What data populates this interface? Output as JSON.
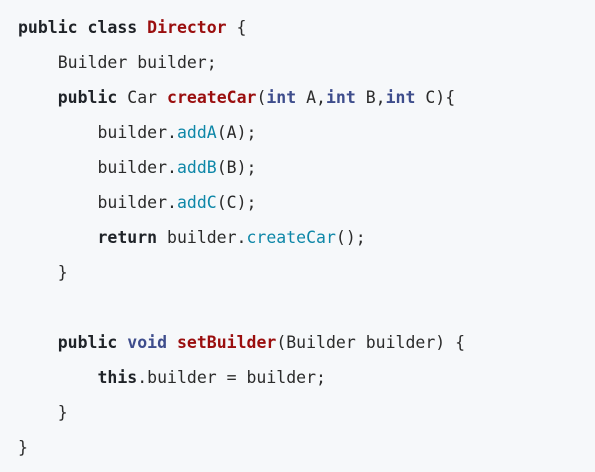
{
  "code": {
    "lines": [
      [
        [
          "kw",
          "public class "
        ],
        [
          "cls",
          "Director"
        ],
        [
          "pl",
          " {"
        ]
      ],
      [
        [
          "pl",
          "    Builder builder;"
        ]
      ],
      [
        [
          "kw",
          "    public "
        ],
        [
          "pl",
          "Car "
        ],
        [
          "cls",
          "createCar"
        ],
        [
          "pl",
          "("
        ],
        [
          "ty",
          "int"
        ],
        [
          "pl",
          " A,"
        ],
        [
          "ty",
          "int"
        ],
        [
          "pl",
          " B,"
        ],
        [
          "ty",
          "int"
        ],
        [
          "pl",
          " C){"
        ]
      ],
      [
        [
          "pl",
          "        builder."
        ],
        [
          "fn",
          "addA"
        ],
        [
          "pl",
          "(A);"
        ]
      ],
      [
        [
          "pl",
          "        builder."
        ],
        [
          "fn",
          "addB"
        ],
        [
          "pl",
          "(B);"
        ]
      ],
      [
        [
          "pl",
          "        builder."
        ],
        [
          "fn",
          "addC"
        ],
        [
          "pl",
          "(C);"
        ]
      ],
      [
        [
          "kw",
          "        return "
        ],
        [
          "pl",
          "builder."
        ],
        [
          "fn",
          "createCar"
        ],
        [
          "pl",
          "();"
        ]
      ],
      [
        [
          "pl",
          "    }"
        ]
      ],
      [
        [
          "pl",
          ""
        ]
      ],
      [
        [
          "kw",
          "    public "
        ],
        [
          "ty",
          "void"
        ],
        [
          "pl",
          " "
        ],
        [
          "cls",
          "setBuilder"
        ],
        [
          "pl",
          "(Builder builder) {"
        ]
      ],
      [
        [
          "kw",
          "        this"
        ],
        [
          "pl",
          ".builder = builder;"
        ]
      ],
      [
        [
          "pl",
          "    }"
        ]
      ],
      [
        [
          "pl",
          "}"
        ]
      ]
    ]
  },
  "colors": {
    "background": "#f6f8fa",
    "keyword": "#1f2328",
    "class_name": "#9a0e0e",
    "method_call": "#0e87a8",
    "type": "#3e4d8c",
    "plain": "#2b2b2b"
  }
}
